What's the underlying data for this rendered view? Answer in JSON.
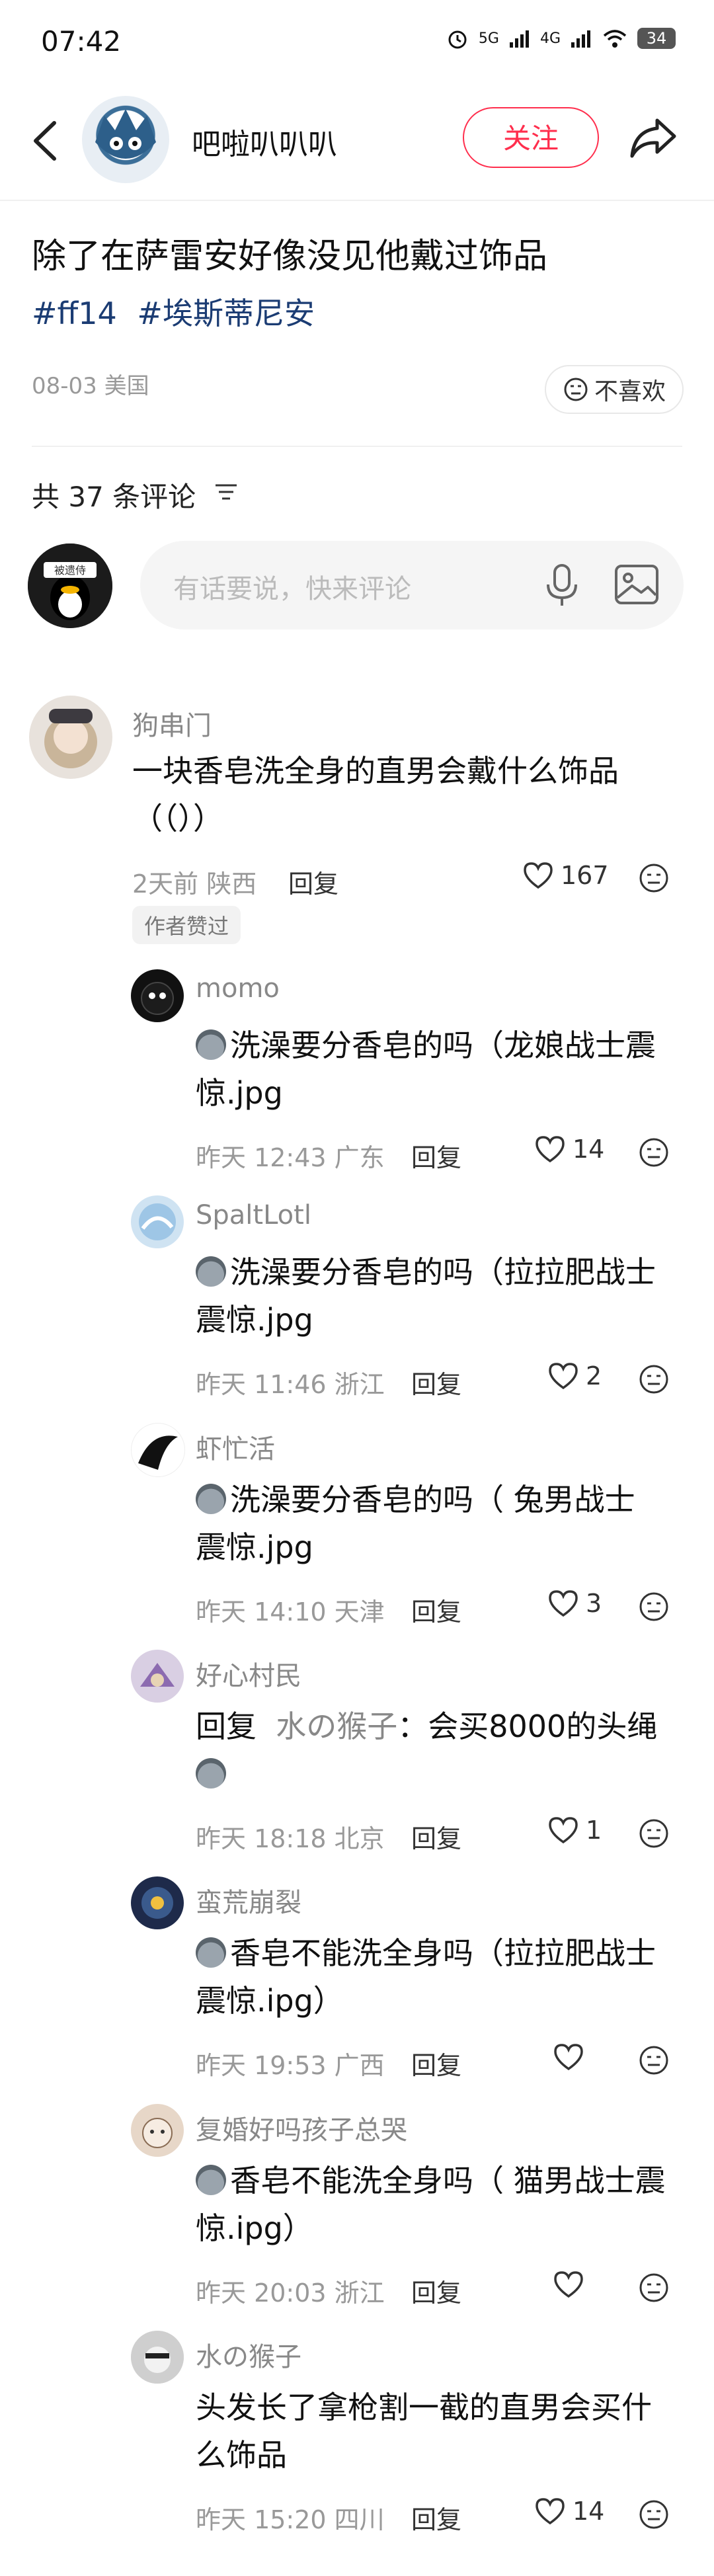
{
  "status_bar": {
    "time": "07:42",
    "network_1": "5G",
    "network_2": "4G",
    "battery": "34"
  },
  "header": {
    "author_name": "吧啦叭叭叭",
    "follow_label": "关注"
  },
  "post": {
    "title": "除了在萨雷安好像没见他戴过饰品",
    "tags": [
      "#ff14",
      "#埃斯蒂尼安"
    ],
    "meta": "08-03 美国",
    "dislike_label": "不喜欢"
  },
  "comments_header": {
    "count_label": "共 37 条评论"
  },
  "comment_input": {
    "placeholder": "有话要说，快来评论",
    "my_avatar_text": "被遗侍"
  },
  "reply_label": "回复",
  "comments": [
    {
      "user": "狗串门",
      "text_line1": "一块香皂洗全身的直男会戴什么饰品",
      "text_line2": "（（））",
      "meta": "2天前 陕西",
      "likes": "167",
      "badge": "作者赞过"
    }
  ],
  "replies": [
    {
      "user": "momo",
      "line1": "洗澡要分香皂的吗（龙娘战士震",
      "line2": "惊.jpg",
      "meta": "昨天 12:43 广东",
      "likes": "14"
    },
    {
      "user": "SpaltLotl",
      "line1": "洗澡要分香皂的吗（拉拉肥战士",
      "line2": "震惊.jpg",
      "meta": "昨天 11:46 浙江",
      "likes": "2"
    },
    {
      "user": "虾忙活",
      "line1": "洗澡要分香皂的吗（ 兔男战士",
      "line2": "震惊.jpg",
      "meta": "昨天 14:10 天津",
      "likes": "3"
    },
    {
      "user": "好心村民",
      "reply_prefix": "回复",
      "quote_user": "水の猴子",
      "line1": "：会买8000的头绳",
      "meta": "昨天 18:18 北京",
      "likes": "1"
    },
    {
      "user": "蛮荒崩裂",
      "line1": "香皂不能洗全身吗（拉拉肥战士",
      "line2": "震惊.ipg）",
      "meta": "昨天 19:53 广西",
      "likes": ""
    },
    {
      "user": "复婚好吗孩子总哭",
      "line1": "香皂不能洗全身吗（ 猫男战士震",
      "line2": "惊.ipg）",
      "meta": "昨天 20:03 浙江",
      "likes": ""
    },
    {
      "user": "水の猴子",
      "line1": "头发长了拿枪割一截的直男会买什",
      "line2": "么饰品",
      "meta": "昨天 15:20 四川",
      "likes": "14"
    }
  ],
  "colors": {
    "accent": "#ff2e4d",
    "tag": "#1b3c73",
    "muted": "#999999"
  }
}
